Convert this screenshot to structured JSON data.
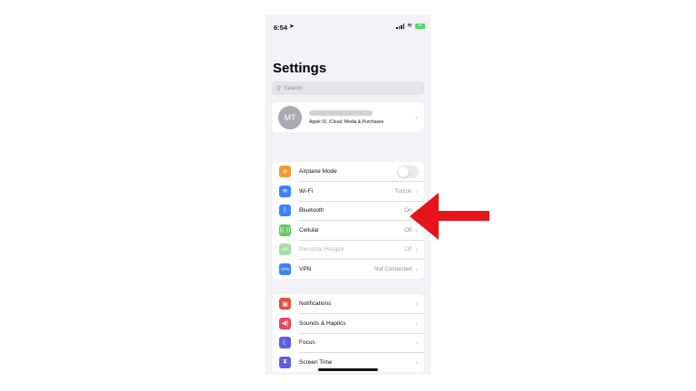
{
  "status": {
    "time": "6:54",
    "battery": "80"
  },
  "page": {
    "title": "Settings"
  },
  "search": {
    "placeholder": "Search"
  },
  "profile": {
    "initials": "MT",
    "subtitle": "Apple ID, iCloud, Media & Purchases"
  },
  "connectivity": [
    {
      "label": "Airplane Mode",
      "value": "",
      "icon": "airplane-icon",
      "color": "#f19a38",
      "toggle": true
    },
    {
      "label": "Wi-Fi",
      "value": "Tuizon",
      "icon": "wifi-icon",
      "color": "#3a82f7"
    },
    {
      "label": "Bluetooth",
      "value": "On",
      "icon": "bluetooth-icon",
      "color": "#3a82f7"
    },
    {
      "label": "Cellular",
      "value": "Off",
      "icon": "cellular-icon",
      "color": "#65c466"
    },
    {
      "label": "Personal Hotspot",
      "value": "Off",
      "icon": "hotspot-icon",
      "color": "#a8dfa9",
      "dim": true
    },
    {
      "label": "VPN",
      "value": "Not Connected",
      "icon": "vpn-icon",
      "color": "#3a82f7"
    }
  ],
  "general": [
    {
      "label": "Notifications",
      "icon": "notifications-icon",
      "color": "#eb4e3d"
    },
    {
      "label": "Sounds & Haptics",
      "icon": "speaker-icon",
      "color": "#eb445a"
    },
    {
      "label": "Focus",
      "icon": "moon-icon",
      "color": "#5e5ce6"
    },
    {
      "label": "Screen Time",
      "icon": "hourglass-icon",
      "color": "#5e5ce6"
    }
  ],
  "colors": {
    "annotation_arrow": "#e8141b",
    "background": "#f2f2f7"
  }
}
